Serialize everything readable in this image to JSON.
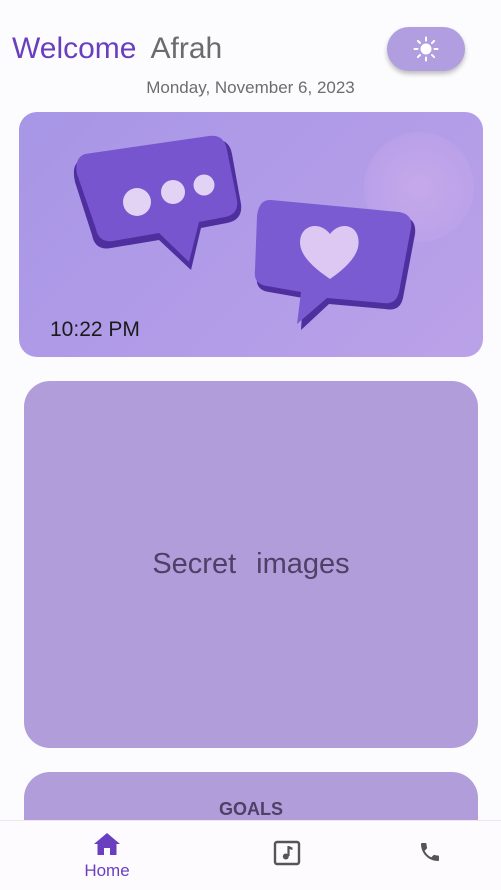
{
  "header": {
    "welcome": "Welcome",
    "user_name": "Afrah",
    "date": "Monday, November 6, 2023",
    "theme_icon": "sun-icon"
  },
  "hero": {
    "time": "10:22 PM",
    "illustration": "chat-bubbles-illustration"
  },
  "cards": {
    "secret_images": "Secret  images",
    "goals": "GOALS"
  },
  "bottom_nav": {
    "items": [
      {
        "label": "Home",
        "icon": "home-icon",
        "active": true
      },
      {
        "label": "",
        "icon": "music-note-icon",
        "active": false
      },
      {
        "label": "",
        "icon": "phone-icon",
        "active": false
      }
    ]
  },
  "colors": {
    "accent": "#6a3fbf",
    "card": "#b29ddb",
    "toggle": "#b19ee0",
    "muted_text": "#6d6d6d"
  }
}
